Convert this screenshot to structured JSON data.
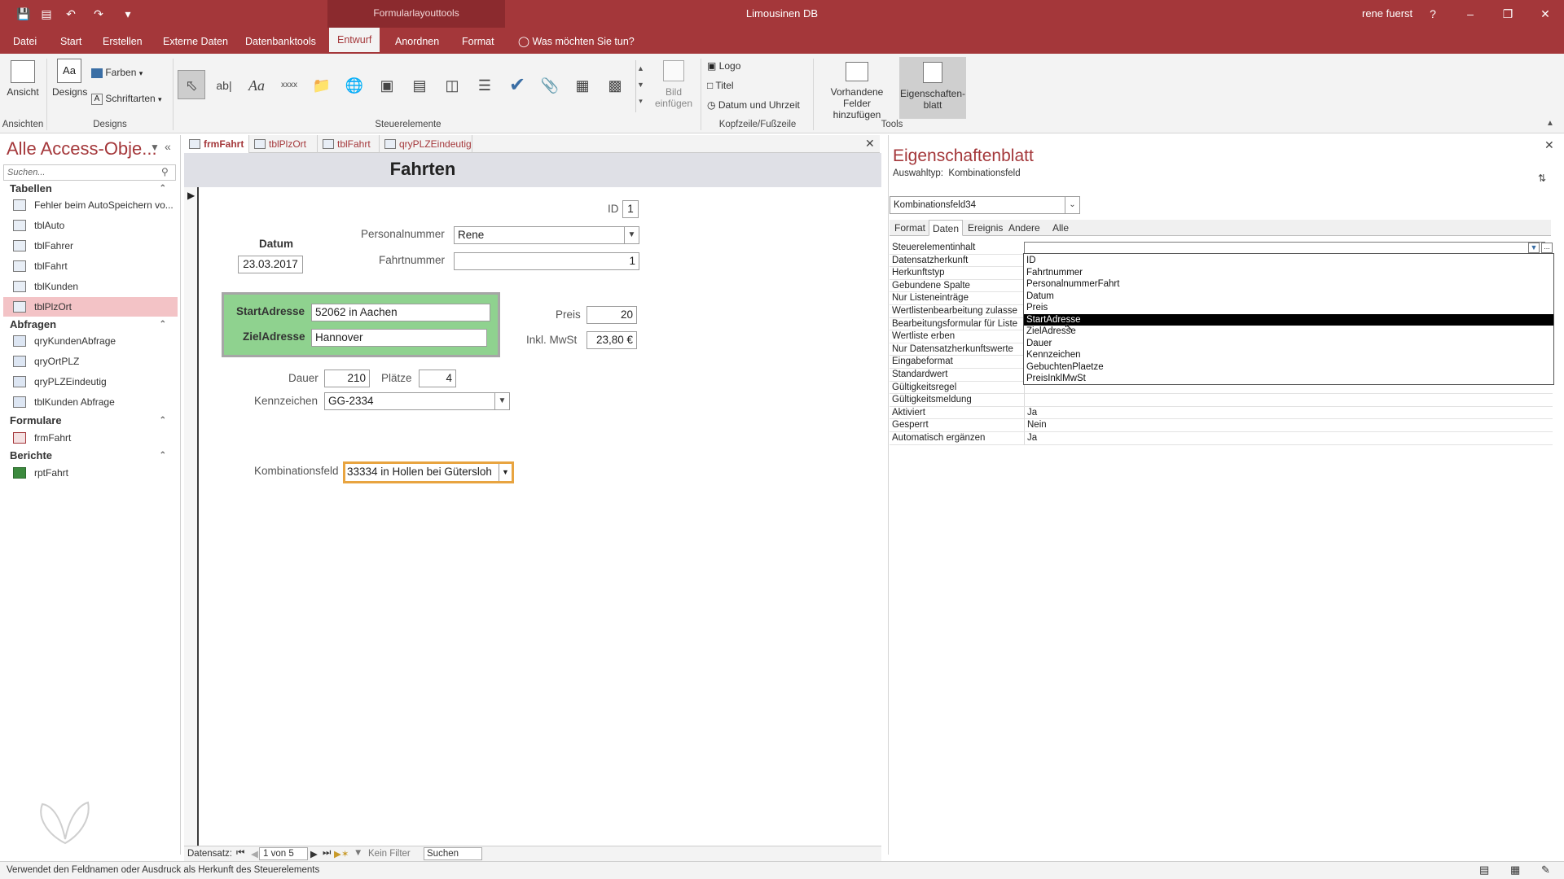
{
  "window": {
    "app_title": "Limousinen DB",
    "context_tab": "Formularlayouttools",
    "user": "rene fuerst",
    "help": "?"
  },
  "ribbon_tabs": [
    "Datei",
    "Start",
    "Erstellen",
    "Externe Daten",
    "Datenbanktools",
    "Entwurf",
    "Anordnen",
    "Format"
  ],
  "ribbon_active_tab": "Entwurf",
  "tell_me": "Was möchten Sie tun?",
  "ribbon": {
    "ansicht": "Ansicht",
    "designs": "Designs",
    "farben": "Farben",
    "schriftarten": "Schriftarten",
    "group_ansichten": "Ansichten",
    "group_designs": "Designs",
    "group_steuerelemente": "Steuerelemente",
    "bild_einfuegen_1": "Bild",
    "bild_einfuegen_2": "einfügen",
    "logo": "Logo",
    "titel": "Titel",
    "datum_uhrzeit": "Datum und Uhrzeit",
    "group_kopfzeile": "Kopfzeile/Fußzeile",
    "vorhandene_1": "Vorhandene",
    "vorhandene_2": "Felder hinzufügen",
    "eigenschaften_1": "Eigenschaften-",
    "eigenschaften_2": "blatt",
    "group_tools": "Tools",
    "ctl_text_aa": "Aa",
    "ctl_text_ab": "ab|",
    "ctl_text_xxxx": "xxxx"
  },
  "nav": {
    "title": "Alle Access-Obje...",
    "search_placeholder": "Suchen...",
    "sections": {
      "tabellen": "Tabellen",
      "abfragen": "Abfragen",
      "formulare": "Formulare",
      "berichte": "Berichte"
    },
    "tabellen": [
      "Fehler beim AutoSpeichern vo...",
      "tblAuto",
      "tblFahrer",
      "tblFahrt",
      "tblKunden",
      "tblPlzOrt"
    ],
    "abfragen": [
      "qryKundenAbfrage",
      "qryOrtPLZ",
      "qryPLZEindeutig",
      "tblKunden Abfrage"
    ],
    "formulare": [
      "frmFahrt"
    ],
    "berichte": [
      "rptFahrt"
    ],
    "selected": "tblPlzOrt"
  },
  "doc_tabs": [
    "frmFahrt",
    "tblPlzOrt",
    "tblFahrt",
    "qryPLZEindeutig"
  ],
  "doc_active": "frmFahrt",
  "form": {
    "title": "Fahrten",
    "id_label": "ID",
    "id_value": "1",
    "datum_label": "Datum",
    "datum_value": "23.03.2017",
    "personalnummer_label": "Personalnummer",
    "personalnummer_value": "Rene",
    "fahrtnummer_label": "Fahrtnummer",
    "fahrtnummer_value": "1",
    "startadresse_label": "StartAdresse",
    "startadresse_value": "52062 in Aachen",
    "zieladresse_label": "ZielAdresse",
    "zieladresse_value": "Hannover",
    "preis_label": "Preis",
    "preis_value": "20",
    "mwst_label": "Inkl. MwSt",
    "mwst_value": "23,80 €",
    "dauer_label": "Dauer",
    "dauer_value": "210",
    "plaetze_label": "Plätze",
    "plaetze_value": "4",
    "kennzeichen_label": "Kennzeichen",
    "kennzeichen_value": "GG-2334",
    "kombi_label": "Kombinationsfeld",
    "kombi_value": "33334 in Hollen bei Gütersloh"
  },
  "record_nav": {
    "label": "Datensatz:",
    "position": "1 von 5",
    "filter": "Kein Filter",
    "search": "Suchen"
  },
  "status": "Verwendet den Feldnamen oder Ausdruck als Herkunft des Steuerelements",
  "props": {
    "title": "Eigenschaftenblatt",
    "auswahltyp_label": "Auswahltyp:",
    "auswahltyp_value": "Kombinationsfeld",
    "object": "Kombinationsfeld34",
    "tabs": [
      "Format",
      "Daten",
      "Ereignis",
      "Andere",
      "Alle"
    ],
    "active_tab": "Daten",
    "rows": [
      {
        "name": "Steuerelementinhalt",
        "value": ""
      },
      {
        "name": "Datensatzherkunft",
        "value": ""
      },
      {
        "name": "Herkunftstyp",
        "value": ""
      },
      {
        "name": "Gebundene Spalte",
        "value": ""
      },
      {
        "name": "Nur Listeneinträge",
        "value": ""
      },
      {
        "name": "Wertlistenbearbeitung zulasse",
        "value": ""
      },
      {
        "name": "Bearbeitungsformular für Liste",
        "value": ""
      },
      {
        "name": "Wertliste erben",
        "value": ""
      },
      {
        "name": "Nur Datensatzherkunftswerte",
        "value": ""
      },
      {
        "name": "Eingabeformat",
        "value": ""
      },
      {
        "name": "Standardwert",
        "value": ""
      },
      {
        "name": "Gültigkeitsregel",
        "value": ""
      },
      {
        "name": "Gültigkeitsmeldung",
        "value": ""
      },
      {
        "name": "Aktiviert",
        "value": "Ja"
      },
      {
        "name": "Gesperrt",
        "value": "Nein"
      },
      {
        "name": "Automatisch ergänzen",
        "value": "Ja"
      }
    ],
    "dropdown_options": [
      "ID",
      "Fahrtnummer",
      "PersonalnummerFahrt",
      "Datum",
      "Preis",
      "StartAdresse",
      "ZielAdresse",
      "Dauer",
      "Kennzeichen",
      "GebuchtenPlaetze",
      "PreisInklMwSt"
    ],
    "dropdown_highlighted": "StartAdresse"
  }
}
